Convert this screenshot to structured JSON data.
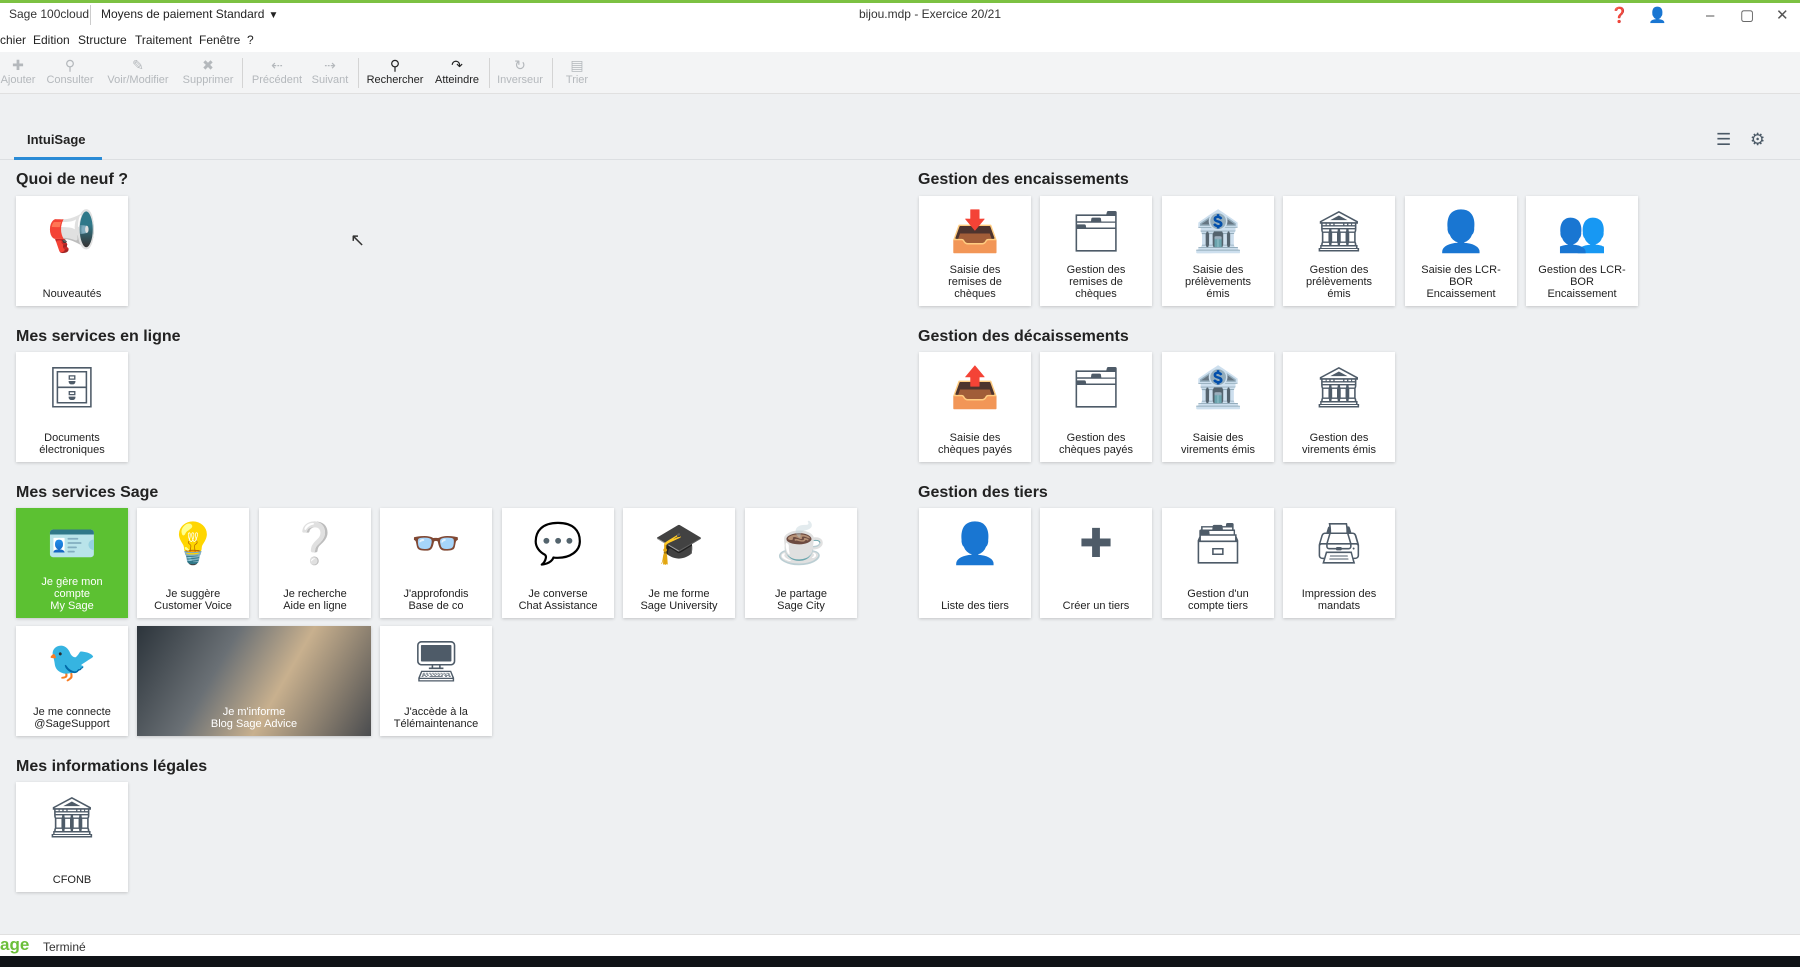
{
  "window": {
    "app_name": "Sage 100cloud",
    "selector": "Moyens de paiement Standard",
    "title": "bijou.mdp - Exercice 20/21"
  },
  "menu": [
    "chier",
    "Edition",
    "Structure",
    "Traitement",
    "Fenêtre",
    "?"
  ],
  "toolbar": [
    {
      "label": "Ajouter",
      "icon": "add-icon",
      "glyph": "✚",
      "enabled": false
    },
    {
      "label": "Consulter",
      "icon": "consult-icon",
      "glyph": "⚲",
      "enabled": false
    },
    {
      "label": "Voir/Modifier",
      "icon": "edit-icon",
      "glyph": "✎",
      "enabled": false
    },
    {
      "label": "Supprimer",
      "icon": "delete-icon",
      "glyph": "✖",
      "enabled": false
    },
    {
      "label": "Précédent",
      "icon": "previous-icon",
      "glyph": "⇠",
      "enabled": false
    },
    {
      "label": "Suivant",
      "icon": "next-icon",
      "glyph": "⇢",
      "enabled": false
    },
    {
      "label": "Rechercher",
      "icon": "search-icon",
      "glyph": "⚲",
      "enabled": true
    },
    {
      "label": "Atteindre",
      "icon": "goto-icon",
      "glyph": "↷",
      "enabled": true
    },
    {
      "label": "Inverseur",
      "icon": "invert-icon",
      "glyph": "↻",
      "enabled": false
    },
    {
      "label": "Trier",
      "icon": "sort-icon",
      "glyph": "▤",
      "enabled": false
    }
  ],
  "tab": "IntuiSage",
  "sections": {
    "quoi": "Quoi de neuf ?",
    "services_ligne": "Mes services en ligne",
    "services_sage": "Mes services Sage",
    "legales": "Mes informations légales",
    "encaissements": "Gestion des encaissements",
    "decaissements": "Gestion des décaissements",
    "tiers": "Gestion des tiers"
  },
  "tiles": {
    "nouveautes": "Nouveautés",
    "documents": "Documents\nélectroniques",
    "mysage": "Je gère mon\ncompte\nMy Sage",
    "customer_voice": "Je suggère\nCustomer Voice",
    "aide": "Je recherche\nAide en ligne",
    "base": "J'approfondis\nBase de co",
    "chat": "Je converse\nChat Assistance",
    "university": "Je me forme\nSage University",
    "city": "Je partage\nSage City",
    "twitter": "Je me connecte\n@SageSupport",
    "blog": "Je m'informe\nBlog Sage Advice",
    "telemaintenance": "J'accède à la\nTélémaintenance",
    "cfonb": "CFONB",
    "saisie_remises": "Saisie des\nremises de\nchèques",
    "gestion_remises": "Gestion des\nremises de\nchèques",
    "saisie_prelev": "Saisie des\nprélèvements\némis",
    "gestion_prelev": "Gestion des\nprélèvements\némis",
    "saisie_lcr": "Saisie des LCR-\nBOR\nEncaissement",
    "gestion_lcr": "Gestion des LCR-\nBOR\nEncaissement",
    "saisie_cheques_payes": "Saisie des\nchèques payés",
    "gestion_cheques_payes": "Gestion des\nchèques payés",
    "saisie_virements": "Saisie des\nvirements émis",
    "gestion_virements": "Gestion des\nvirements émis",
    "liste_tiers": "Liste des tiers",
    "creer_tiers": "Créer un tiers",
    "gestion_compte_tiers": "Gestion d'un\ncompte tiers",
    "impression_mandats": "Impression des\nmandats"
  },
  "status": {
    "logo": "age",
    "text": "Terminé"
  },
  "colors": {
    "accent_green": "#5cc132",
    "tab_underline": "#2a8bd6",
    "icon": "#4e5b68"
  }
}
